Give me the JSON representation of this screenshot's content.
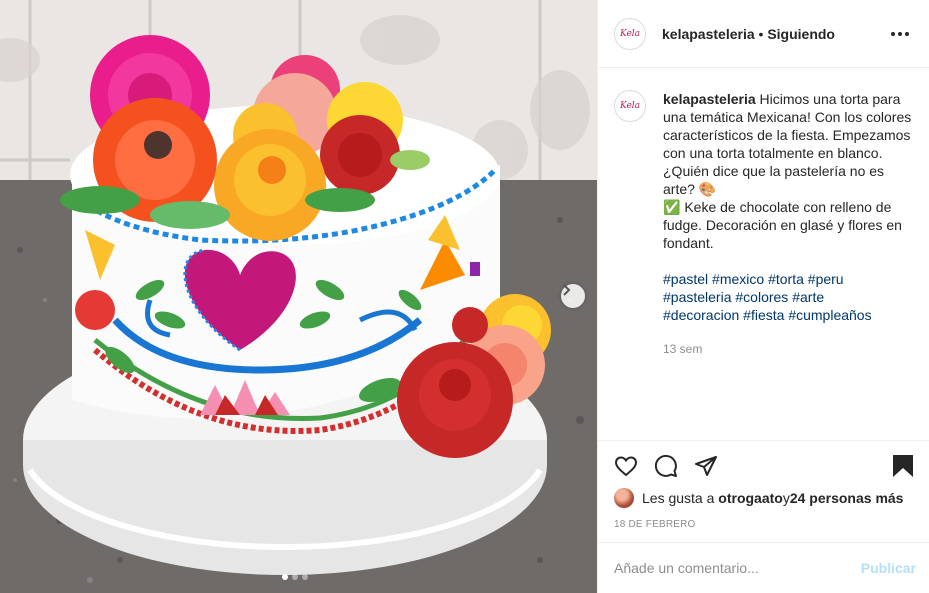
{
  "header": {
    "username": "kelapasteleria",
    "separator": " • ",
    "follow_status": "Siguiendo",
    "avatar_text": "Kela"
  },
  "caption": {
    "username": "kelapasteleria",
    "text_1": "Hicimos una torta para una temática Mexicana! Con los colores característicos de la fiesta. Empezamos con una torta totalmente en blanco. ¿Quién dice que la pastelería no es arte? 🎨",
    "check": "✅",
    "text_2": " Keke de chocolate con relleno de fudge. Decoración en glasé y flores en fondant.",
    "hashtags": [
      "#pastel",
      "#mexico",
      "#torta",
      "#peru",
      "#pasteleria",
      "#colores",
      "#arte",
      "#decoracion",
      "#fiesta",
      "#cumpleaños"
    ],
    "age": "13 sem"
  },
  "actions": {
    "icons": [
      "heart-icon",
      "comment-icon",
      "share-icon",
      "bookmark-icon"
    ]
  },
  "likes": {
    "prefix": "Les gusta a",
    "user": "otrogaato",
    "middle": " y ",
    "others": "24 personas más"
  },
  "date": "18 DE FEBRERO",
  "comment": {
    "placeholder": "Añade un comentario...",
    "publish_label": "Publicar"
  },
  "carousel": {
    "total_slides": 3,
    "active_slide": 1
  },
  "colors": {
    "link": "#00376b",
    "muted": "#8e8e8e",
    "publish_disabled": "#b2dffc"
  }
}
